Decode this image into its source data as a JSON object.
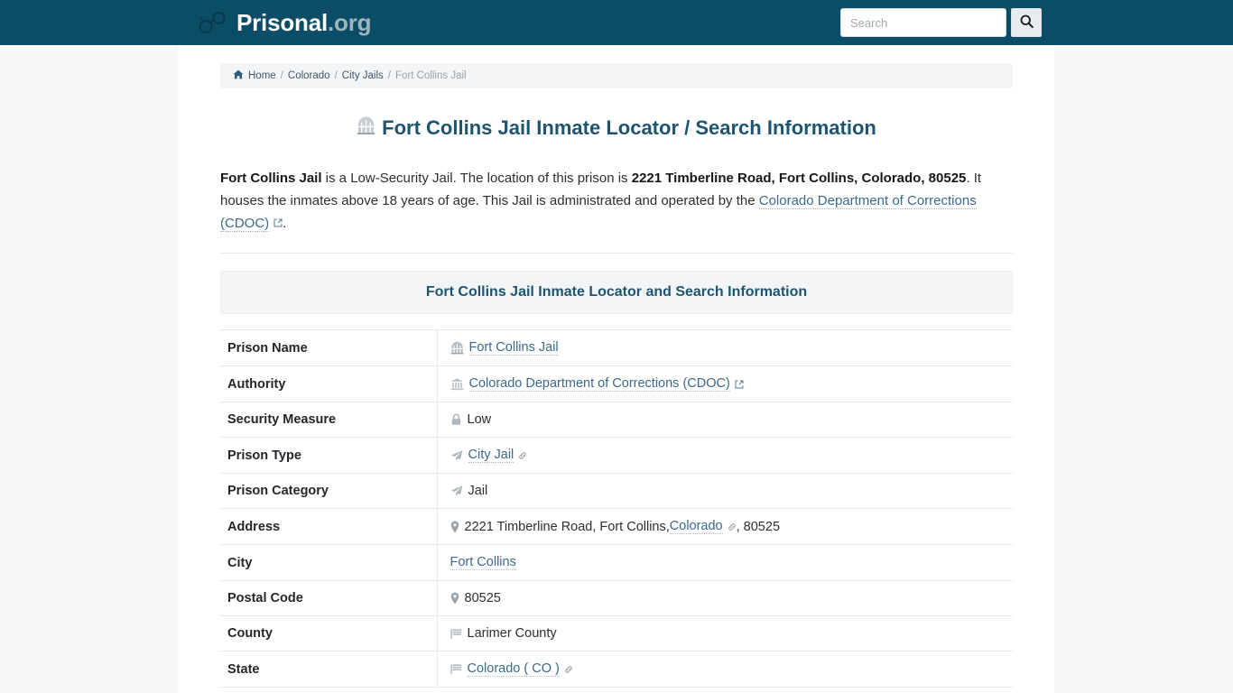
{
  "header": {
    "logo_brand": "Prisonal",
    "logo_tld": ".org",
    "logo_icon": "handcuffs-icon",
    "search_placeholder": "Search",
    "search_value": "",
    "search_button_icon": "search-icon",
    "background_color": "#0b4d66"
  },
  "breadcrumb": {
    "home_icon": "home-icon",
    "items": [
      {
        "label": "Home",
        "link": true
      },
      {
        "label": "Colorado",
        "link": true
      },
      {
        "label": "City Jails",
        "link": true
      },
      {
        "label": "Fort Collins Jail",
        "link": false
      }
    ],
    "separator": "/"
  },
  "page": {
    "title": "Fort Collins Jail Inmate Locator / Search Information",
    "title_icon": "jail-door-icon",
    "title_color": "#1d5570"
  },
  "intro": {
    "part1_bold": "Fort Collins Jail",
    "part2": " is a Low-Security Jail. The location of this prison is ",
    "part3_bold": "2221 Timberline Road, Fort Collins, Colorado, 80525",
    "part4": ". It houses the inmates above 18 years of age. This Jail is administrated and operated by the ",
    "link_text": "Colorado Department of Corrections (CDOC)",
    "link_icon": "external-link-icon",
    "part5": "."
  },
  "section": {
    "heading": "Fort Collins Jail Inmate Locator and Search Information"
  },
  "table": {
    "rows": [
      {
        "label": "Prison Name",
        "icon": "jail-door-icon",
        "value": "Fort Collins Jail",
        "is_link": true,
        "trailing_icon": ""
      },
      {
        "label": "Authority",
        "icon": "bank-building-icon",
        "value": "Colorado Department of Corrections (CDOC)",
        "is_link": true,
        "trailing_icon": "external-link-icon"
      },
      {
        "label": "Security Measure",
        "icon": "lock-icon",
        "value": "Low",
        "is_link": false,
        "trailing_icon": ""
      },
      {
        "label": "Prison Type",
        "icon": "paper-plane-icon",
        "value": "City Jail",
        "is_link": true,
        "trailing_icon": "chain-link-icon"
      },
      {
        "label": "Prison Category",
        "icon": "paper-plane-icon",
        "value": "Jail",
        "is_link": false,
        "trailing_icon": ""
      },
      {
        "label": "Address",
        "icon": "map-marker-icon",
        "value": "",
        "is_link": false,
        "trailing_icon": "",
        "address_pre": "2221 Timberline Road, Fort Collins, ",
        "address_link": "Colorado",
        "address_link_icon": "chain-link-icon",
        "address_post": ", 80525"
      },
      {
        "label": "City",
        "icon": "",
        "value": "Fort Collins",
        "is_link": true,
        "trailing_icon": ""
      },
      {
        "label": "Postal Code",
        "icon": "map-marker-icon",
        "value": "80525",
        "is_link": false,
        "trailing_icon": ""
      },
      {
        "label": "County",
        "icon": "flag-icon",
        "value": "Larimer County",
        "is_link": false,
        "trailing_icon": ""
      },
      {
        "label": "State",
        "icon": "flag-icon",
        "value": "Colorado ( CO )",
        "is_link": true,
        "trailing_icon": "chain-link-icon"
      }
    ]
  },
  "colors": {
    "header_bg": "#0b4d66",
    "accent": "#1d5570",
    "link": "#3b6a8a",
    "page_bg": "#f6f8fa",
    "panel_bg": "#f4f5f6"
  }
}
